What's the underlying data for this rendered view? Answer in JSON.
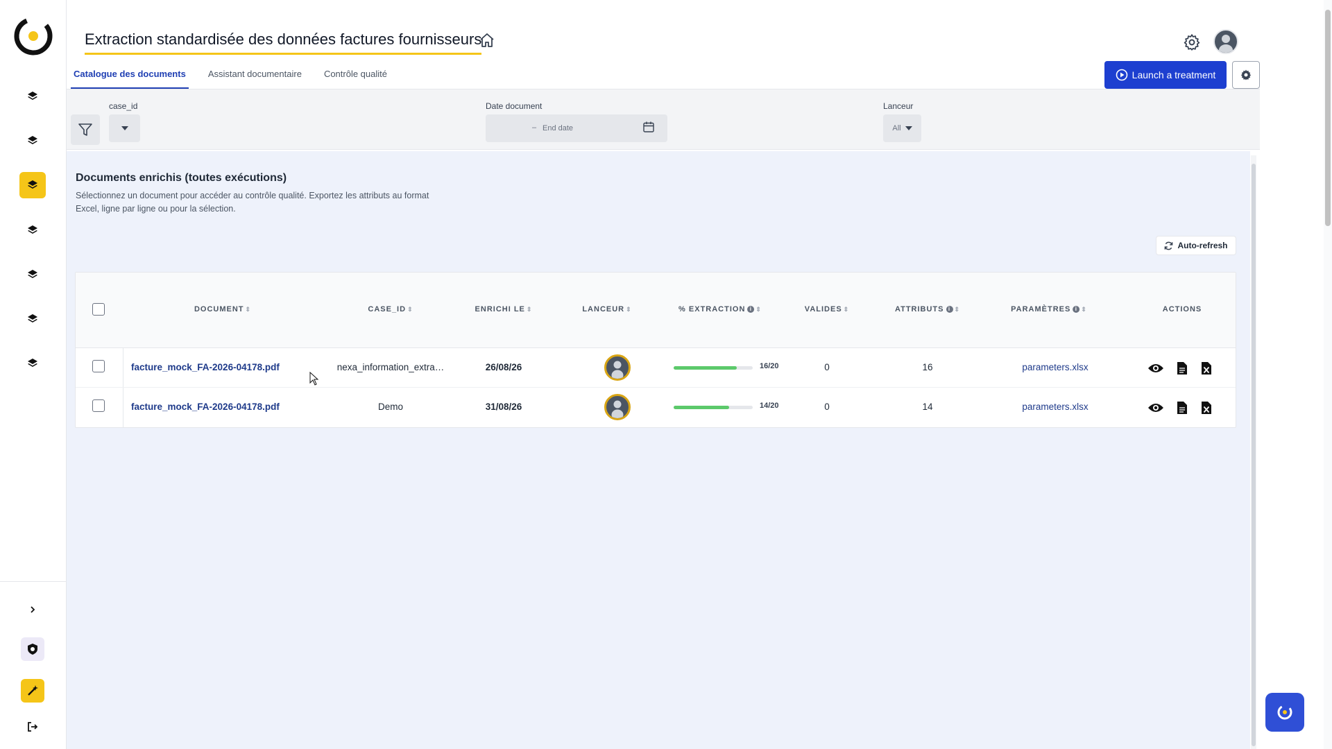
{
  "app": {
    "logo_icon": "app-logo-icon"
  },
  "header": {
    "title": "Extraction standardisée des données factures fournisseurs",
    "home_icon": "home-icon",
    "settings_icon": "gear-icon",
    "avatar_icon": "user-avatar"
  },
  "sidebar": {
    "items": [
      {
        "icon": "layers-icon",
        "active": false
      },
      {
        "icon": "layers-icon",
        "active": false
      },
      {
        "icon": "layers-icon",
        "active": true
      },
      {
        "icon": "layers-icon",
        "active": false
      },
      {
        "icon": "layers-icon",
        "active": false
      },
      {
        "icon": "layers-icon",
        "active": false
      },
      {
        "icon": "layers-icon",
        "active": false
      }
    ],
    "bottom": [
      "chevron-right-icon",
      "shield-icon",
      "magic-wand-icon",
      "logout-icon"
    ]
  },
  "tabs": [
    {
      "label": "Catalogue des documents",
      "active": true
    },
    {
      "label": "Assistant documentaire",
      "active": false
    },
    {
      "label": "Contrôle qualité",
      "active": false
    }
  ],
  "toolbar": {
    "launch_label": "Launch a treatment"
  },
  "filters": {
    "case_label": "case_id",
    "date_label": "Date document",
    "date_separator": "–",
    "date_end_placeholder": "End date",
    "lanceur_label": "Lanceur",
    "lanceur_value": "All"
  },
  "section": {
    "title": "Documents enrichis (toutes exécutions)",
    "description": "Sélectionnez un document pour accéder au contrôle qualité. Exportez les attributs au format Excel, ligne par ligne ou pour la sélection.",
    "autorefresh_label": "Auto-refresh"
  },
  "table": {
    "columns": {
      "document": "DOCUMENT",
      "case_id": "CASE_ID",
      "enrichi": "ENRICHI LE",
      "lanceur": "LANCEUR",
      "extraction": "% EXTRACTION",
      "valides": "VALIDES",
      "attributs": "ATTRIBUTS",
      "parametres": "PARAMÈTRES",
      "actions": "ACTIONS"
    },
    "rows": [
      {
        "document": "facture_mock_FA-2026-04178.pdf",
        "case_id": "nexa_information_extra…",
        "enrichi": "26/08/26",
        "extraction_ratio": "16/20",
        "extraction_fraction": 0.8,
        "valides": "0",
        "attributs": "16",
        "parametres": "parameters.xlsx"
      },
      {
        "document": "facture_mock_FA-2026-04178.pdf",
        "case_id": "Demo",
        "enrichi": "31/08/26",
        "extraction_ratio": "14/20",
        "extraction_fraction": 0.7,
        "valides": "0",
        "attributs": "14",
        "parametres": "parameters.xlsx"
      }
    ],
    "row_actions": [
      "eye-icon",
      "document-icon",
      "excel-export-icon"
    ]
  },
  "colors": {
    "primary": "#1d3fd0",
    "accent": "#f5c518",
    "progress": "#5cc96b",
    "panel": "#eef2fb"
  },
  "chat": {
    "icon": "assistant-chat-icon"
  }
}
